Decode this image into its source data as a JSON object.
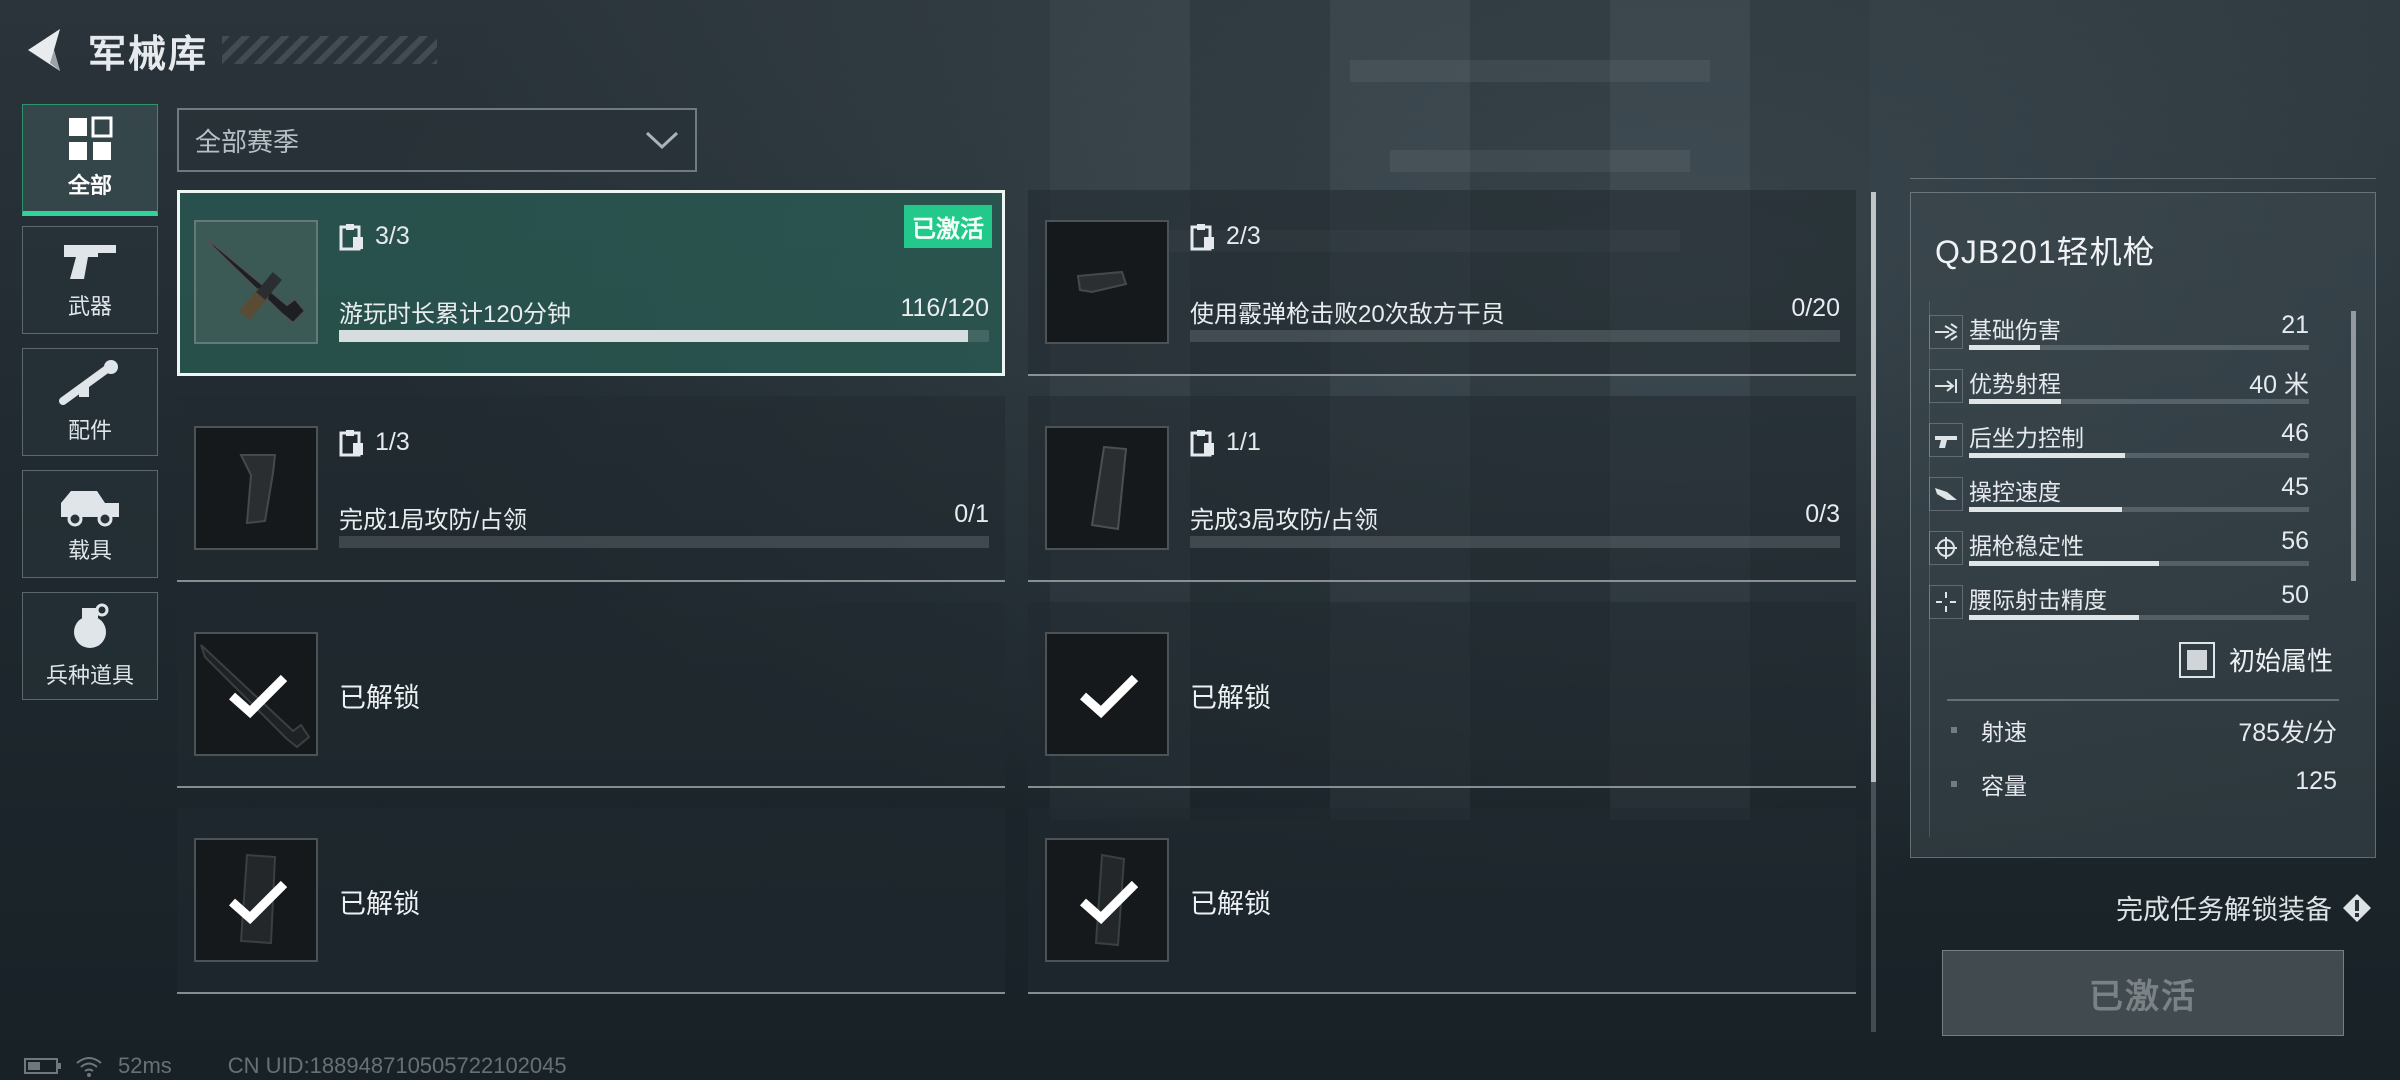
{
  "header": {
    "title": "军械库"
  },
  "categories": [
    {
      "label": "全部",
      "icon": "grid-icon",
      "active": true
    },
    {
      "label": "武器",
      "icon": "pistol-icon"
    },
    {
      "label": "配件",
      "icon": "scope-icon"
    },
    {
      "label": "载具",
      "icon": "vehicle-icon"
    },
    {
      "label": "兵种道具",
      "icon": "grenade-icon"
    }
  ],
  "season_filter": {
    "value": "全部赛季"
  },
  "tasks": [
    {
      "count": "3/3",
      "task": "游玩时长累计120分钟",
      "progress": "116/120",
      "progress_fraction": 0.967,
      "badge": "已激活",
      "thumb": "rifle-thumbnail"
    },
    {
      "count": "2/3",
      "task": "使用霰弹枪击败20次敌方干员",
      "progress": "0/20",
      "progress_fraction": 0,
      "thumb": "stock-thumbnail"
    },
    {
      "count": "1/3",
      "task": "完成1局攻防/占领",
      "progress": "0/1",
      "progress_fraction": 0,
      "thumb": "grip-thumbnail"
    },
    {
      "count": "1/1",
      "task": "完成3局攻防/占领",
      "progress": "0/3",
      "progress_fraction": 0,
      "thumb": "magazine-thumbnail"
    },
    {
      "status": "已解锁"
    },
    {
      "status": "已解锁"
    },
    {
      "status": "已解锁"
    },
    {
      "status": "已解锁"
    }
  ],
  "detail": {
    "weapon_name": "QJB201轻机枪",
    "stats": [
      {
        "label": "基础伤害",
        "value": "21",
        "fraction": 0.21,
        "icon": "damage-icon"
      },
      {
        "label": "优势射程",
        "value": "40 米",
        "fraction": 0.27,
        "icon": "range-icon"
      },
      {
        "label": "后坐力控制",
        "value": "46",
        "fraction": 0.46,
        "icon": "recoil-icon"
      },
      {
        "label": "操控速度",
        "value": "45",
        "fraction": 0.45,
        "icon": "handling-icon"
      },
      {
        "label": "据枪稳定性",
        "value": "56",
        "fraction": 0.56,
        "icon": "crosshair-icon"
      },
      {
        "label": "腰际射击精度",
        "value": "50",
        "fraction": 0.5,
        "icon": "hipfire-icon"
      }
    ],
    "base_attr_toggle": "初始属性",
    "extra": [
      {
        "label": "射速",
        "value": "785发/分"
      },
      {
        "label": "容量",
        "value": "125"
      }
    ],
    "unlock_hint": "完成任务解锁装备",
    "action_button": "已激活"
  },
  "status": {
    "ping": "52ms",
    "uid": "CN UID:188948710505722102045"
  },
  "colors": {
    "accent": "#22c98a",
    "active_card": "#2a5c54",
    "background": "#1f292f"
  }
}
